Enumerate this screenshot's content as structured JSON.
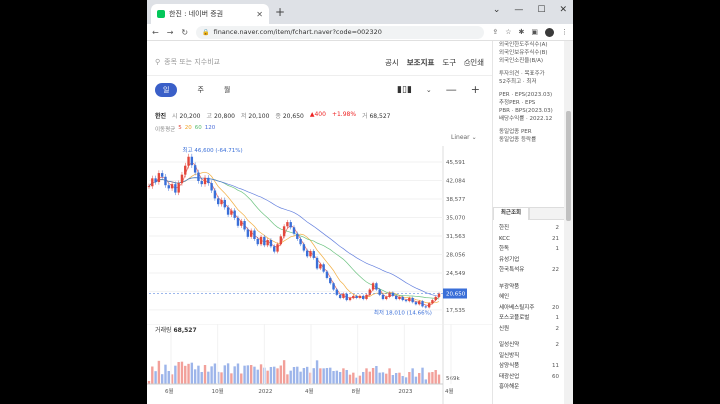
{
  "browser": {
    "tab_title": "한진 : 네이버 증권",
    "url": "finance.naver.com/item/fchart.naver?code=002320"
  },
  "search": {
    "placeholder": "종목 또는 지수비교"
  },
  "top_menu": [
    "공시",
    "보조지표",
    "도구",
    "인쇄"
  ],
  "periods": [
    "일",
    "주",
    "월"
  ],
  "quote": {
    "name": "한진",
    "open_label": "시",
    "open": "20,200",
    "high_label": "고",
    "high": "20,800",
    "low_label": "저",
    "low": "20,100",
    "close_label": "종",
    "close": "20,650",
    "change": "▲400",
    "change_pct": "+1.98%",
    "volume_label": "거",
    "volume": "68,527"
  },
  "ma": {
    "label": "이동평균",
    "periods": [
      "5",
      "20",
      "60",
      "120"
    ]
  },
  "scale_mode": "Linear",
  "chart_data": {
    "type": "line",
    "title": "",
    "x_ticks": [
      "6월",
      "10월",
      "2022",
      "4월",
      "8월",
      "2023",
      "4월"
    ],
    "y_ticks": [
      45591,
      42084,
      38577,
      35070,
      31563,
      28056,
      24549,
      21042,
      17535
    ],
    "ylim": [
      16000,
      47500
    ],
    "last_price": "20,650",
    "max_label": "최고 46,600 (-64.71%)",
    "min_label": "최저 18,010 (14.66%)",
    "series": [
      {
        "name": "5",
        "color": "#e2473c"
      },
      {
        "name": "20",
        "color": "#f0a020"
      },
      {
        "name": "60",
        "color": "#53b96b"
      },
      {
        "name": "120",
        "color": "#4a6bd8"
      }
    ],
    "close_values": [
      41000,
      42500,
      41800,
      43500,
      42800,
      41200,
      40600,
      41400,
      39800,
      41600,
      43200,
      44900,
      46600,
      45000,
      43600,
      42000,
      41400,
      42600,
      41600,
      40200,
      38700,
      37600,
      38400,
      37000,
      35600,
      36400,
      35000,
      33500,
      34400,
      32800,
      31400,
      32600,
      31000,
      30000,
      31400,
      29800,
      30800,
      29600,
      28600,
      30000,
      31500,
      33400,
      34200,
      33200,
      32000,
      31000,
      30000,
      28800,
      27700,
      28700,
      27400,
      25400,
      26200,
      24800,
      23600,
      22600,
      21400,
      20400,
      19800,
      20600,
      19400,
      19800,
      20200,
      19800,
      20200,
      19600,
      20400,
      21400,
      22600,
      21400,
      20400,
      19600,
      20000,
      20800,
      20200,
      19600,
      20000,
      19400,
      19200,
      19800,
      19000,
      18600,
      19200,
      18200,
      18010,
      18800,
      19400,
      20000,
      20650
    ],
    "volume_label": "거래량",
    "volume_value": "68,527",
    "volume_axis": "569k"
  },
  "right_panel": {
    "info_lines": [
      "외국인한도주식수(A)",
      "외국인보유주식수(B)",
      "외국인소진율(B/A)",
      "투자의견 · 목표주가",
      "52주최고 · 최저",
      "PER · EPS(2023.03)",
      "추정PER · EPS",
      "PBR · BPS(2023.03)",
      "배당수익률 · 2022.12",
      "동일업종 PER",
      "동일업종 등락률"
    ],
    "tabs": [
      "최근조회",
      ""
    ],
    "recent": [
      {
        "name": "한진",
        "value": "2"
      },
      {
        "name": "KCC",
        "value": "21"
      },
      {
        "name": "한독",
        "value": "1"
      },
      {
        "name": "유성기업",
        "value": ""
      },
      {
        "name": "한국특석유",
        "value": "22"
      },
      {
        "name": "부광약품",
        "value": ""
      },
      {
        "name": "혜인",
        "value": ""
      },
      {
        "name": "세아베스틸지주",
        "value": "20"
      },
      {
        "name": "포스코플로벌",
        "value": "1"
      },
      {
        "name": "신원",
        "value": "2"
      },
      {
        "name": "일성신약",
        "value": "2"
      },
      {
        "name": "일신방직",
        "value": ""
      },
      {
        "name": "삼양식품",
        "value": "11"
      },
      {
        "name": "태광산업",
        "value": "60"
      },
      {
        "name": "흥아해운",
        "value": ""
      }
    ]
  }
}
